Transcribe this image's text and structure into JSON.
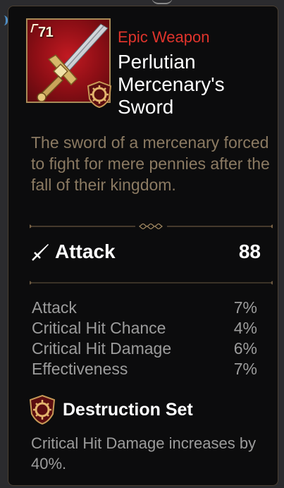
{
  "item": {
    "level": "71",
    "grade": "Epic Weapon",
    "name": "Perlutian Mercenary's Sword",
    "description": "The sword of a mercenary forced to fight for mere pennies after the fall of their kingdom.",
    "icon": "sword-icon",
    "colors": {
      "grade": "#e0342c",
      "frame_bg": "#a8121a",
      "description": "#8b7a62",
      "substat": "#9c9c9c",
      "border": "#4b4032"
    }
  },
  "main_stat": {
    "icon": "attack-sword-icon",
    "label": "Attack",
    "value": "88"
  },
  "substats": [
    {
      "label": "Attack",
      "value": "7%"
    },
    {
      "label": "Critical Hit Chance",
      "value": "4%"
    },
    {
      "label": "Critical Hit Damage",
      "value": "6%"
    },
    {
      "label": "Effectiveness",
      "value": "7%"
    }
  ],
  "set": {
    "icon": "destruction-set-icon",
    "name": "Destruction Set",
    "description": "Critical Hit Damage increases by 40%."
  }
}
